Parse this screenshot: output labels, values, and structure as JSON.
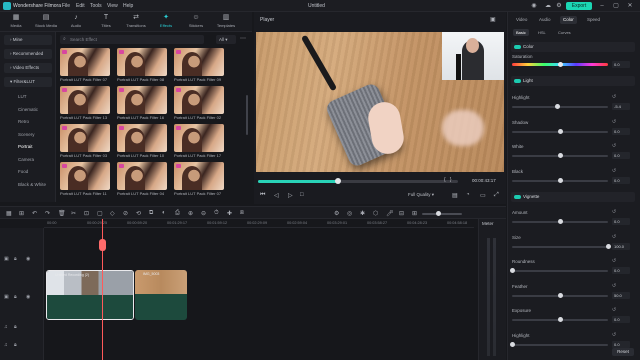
{
  "app": {
    "name": "Wondershare Filmora",
    "doc_title": "Untitled",
    "export_label": "Export"
  },
  "menu": [
    "File",
    "Edit",
    "Tools",
    "View",
    "Help"
  ],
  "toolbar": [
    {
      "label": "Media",
      "icon": "media-icon"
    },
    {
      "label": "Stock Media",
      "icon": "stock-media-icon"
    },
    {
      "label": "Audio",
      "icon": "audio-icon"
    },
    {
      "label": "Titles",
      "icon": "titles-icon"
    },
    {
      "label": "Transitions",
      "icon": "transitions-icon"
    },
    {
      "label": "Effects",
      "icon": "effects-icon",
      "active": true
    },
    {
      "label": "Stickers",
      "icon": "stickers-icon"
    },
    {
      "label": "Templates",
      "icon": "templates-icon"
    }
  ],
  "categories": [
    {
      "label": "Mine",
      "type": "hdr"
    },
    {
      "label": "Recommended",
      "type": "hdr"
    },
    {
      "label": "Video Effects",
      "type": "hdr"
    },
    {
      "label": "Filter&LUT",
      "type": "hdr"
    },
    {
      "label": "LUT",
      "type": "sub"
    },
    {
      "label": "Cinematic",
      "type": "sub"
    },
    {
      "label": "Retro",
      "type": "sub"
    },
    {
      "label": "Scenery",
      "type": "sub"
    },
    {
      "label": "Portrait",
      "type": "sub",
      "selected": true
    },
    {
      "label": "Camera",
      "type": "sub"
    },
    {
      "label": "Food",
      "type": "sub"
    },
    {
      "label": "Black & White",
      "type": "sub"
    }
  ],
  "search": {
    "placeholder": "Search Effect",
    "filter": "All"
  },
  "effects": [
    "Portrait LUT Pack Filter 07",
    "Portrait LUT Pack Filter 08",
    "Portrait LUT Pack Filter 09",
    "Portrait LUT Pack Filter 13",
    "Portrait LUT Pack Filter 16",
    "Portrait LUT Pack Filter 02",
    "Portrait LUT Pack Filter 03",
    "Portrait LUT Pack Filter 10",
    "Portrait LUT Pack Filter 17",
    "Portrait LUT Pack Filter 11",
    "Portrait LUT Pack Filter 04",
    "Portrait LUT Pack Filter 07"
  ],
  "player": {
    "title": "Player",
    "timecode": "00:00:43:17",
    "quality": "Full Quality",
    "progress": 0.4
  },
  "inspector": {
    "tabs": [
      "Video",
      "Audio",
      "Color",
      "Speed"
    ],
    "active_tab": "Color",
    "subtabs": [
      "Basic",
      "HSL",
      "Curves"
    ],
    "active_subtab": "Basic",
    "color_section": "Color",
    "saturation": {
      "label": "Saturation",
      "value": "0.0",
      "pos": 0.5
    },
    "light_section": "Light",
    "light_props": [
      {
        "label": "Highlight",
        "value": "-5.4",
        "pos": 0.47
      },
      {
        "label": "Shadow",
        "value": "0.0",
        "pos": 0.5
      },
      {
        "label": "White",
        "value": "0.0",
        "pos": 0.5
      },
      {
        "label": "Black",
        "value": "0.0",
        "pos": 0.5
      }
    ],
    "vignette_section": "Vignette",
    "vignette_props": [
      {
        "label": "Amount",
        "value": "0.0",
        "pos": 0.5
      },
      {
        "label": "Size",
        "value": "100.0",
        "pos": 1.0
      },
      {
        "label": "Roundness",
        "value": "0.0",
        "pos": 0.0
      },
      {
        "label": "Feather",
        "value": "50.0",
        "pos": 0.5
      },
      {
        "label": "Exposure",
        "value": "0.0",
        "pos": 0.5
      },
      {
        "label": "Highlight",
        "value": "0.0",
        "pos": 0.0
      }
    ],
    "reset_label": "Reset"
  },
  "timeline": {
    "ruler": [
      "00:00",
      "00:00:29:25",
      "00:00:59:20",
      "00:01:29:17",
      "00:01:59:12",
      "00:02:29:09",
      "00:02:59:04",
      "00:03:29:01",
      "00:03:58:27",
      "00:04:28:23",
      "00:04:58:18"
    ],
    "clips": [
      "Untitled Recording (2)",
      "IMG_5003"
    ],
    "meter_label": "Meter"
  }
}
